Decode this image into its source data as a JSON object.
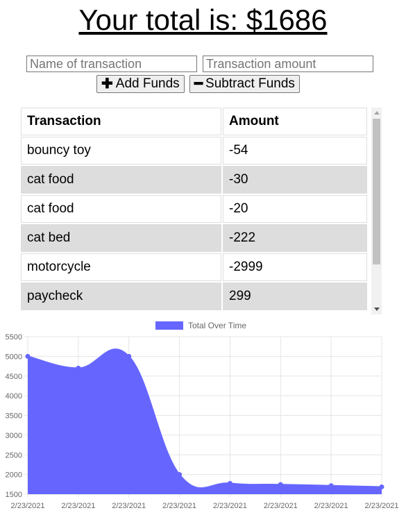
{
  "header": {
    "total_text": "Your total is: $1686"
  },
  "form": {
    "name_placeholder": "Name of transaction",
    "amount_placeholder": "Transaction amount",
    "add_label": "Add Funds",
    "subtract_label": "Subtract Funds"
  },
  "table": {
    "headers": [
      "Transaction",
      "Amount"
    ],
    "rows": [
      {
        "name": "bouncy toy",
        "amount": "-54"
      },
      {
        "name": "cat food",
        "amount": "-30"
      },
      {
        "name": "cat food",
        "amount": "-20"
      },
      {
        "name": "cat bed",
        "amount": "-222"
      },
      {
        "name": "motorcycle",
        "amount": "-2999"
      },
      {
        "name": "paycheck",
        "amount": "299"
      }
    ]
  },
  "colors": {
    "series_fill": "#6666ff",
    "series_line": "#6666ff",
    "alt_row": "#dddddd"
  },
  "chart_data": {
    "type": "area",
    "x": [
      "2/23/2021",
      "2/23/2021",
      "2/23/2021",
      "2/23/2021",
      "2/23/2021",
      "2/23/2021",
      "2/23/2021",
      "2/23/2021"
    ],
    "series": [
      {
        "name": "Total Over Time",
        "values": [
          5000,
          4700,
          5000,
          2000,
          1775,
          1745,
          1716,
          1686
        ]
      }
    ],
    "y_ticks": [
      "5500",
      "5000",
      "4500",
      "4000",
      "3500",
      "3000",
      "2500",
      "2000",
      "1500"
    ],
    "ylim": [
      1500,
      5500
    ],
    "grid": true,
    "legend_position": "top"
  }
}
